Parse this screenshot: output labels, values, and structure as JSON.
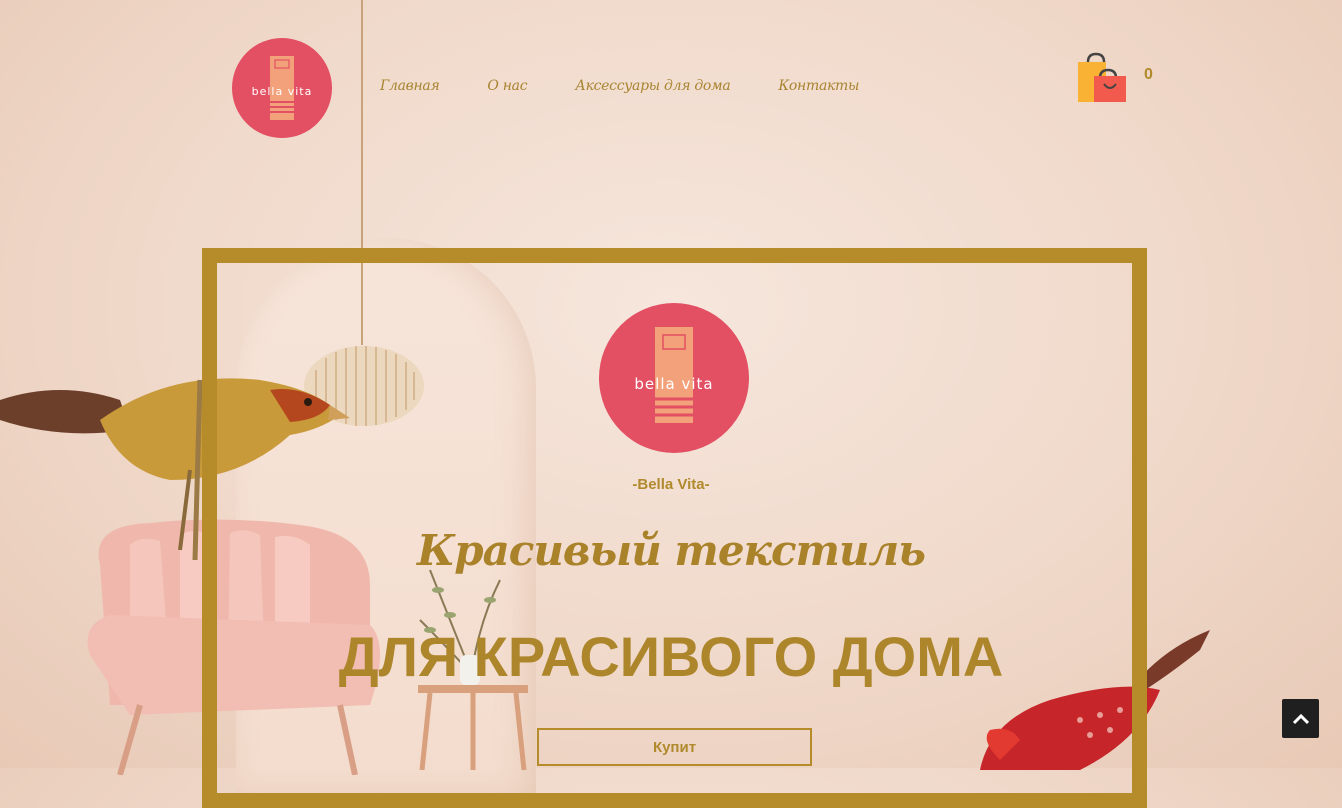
{
  "header": {
    "logo_text": "bella vita",
    "nav": [
      {
        "label": "Главная"
      },
      {
        "label": "О нас"
      },
      {
        "label": "Аксессуары для дома"
      },
      {
        "label": "Контакты"
      }
    ],
    "cart_count": "0"
  },
  "hero": {
    "logo_text": "bella vita",
    "brand_name": "-Bella Vita-",
    "tagline": "Красивый текстиль",
    "headline": "ДЛЯ КРАСИВОГО ДОМА",
    "buy_button": "Купит"
  },
  "colors": {
    "accent_gold": "#b68c2b",
    "logo_pink": "#e34f63",
    "logo_inner": "#f3a17a"
  },
  "icons": {
    "cart": "shopping-bag-icon",
    "scroll_top": "chevron-up-icon"
  }
}
